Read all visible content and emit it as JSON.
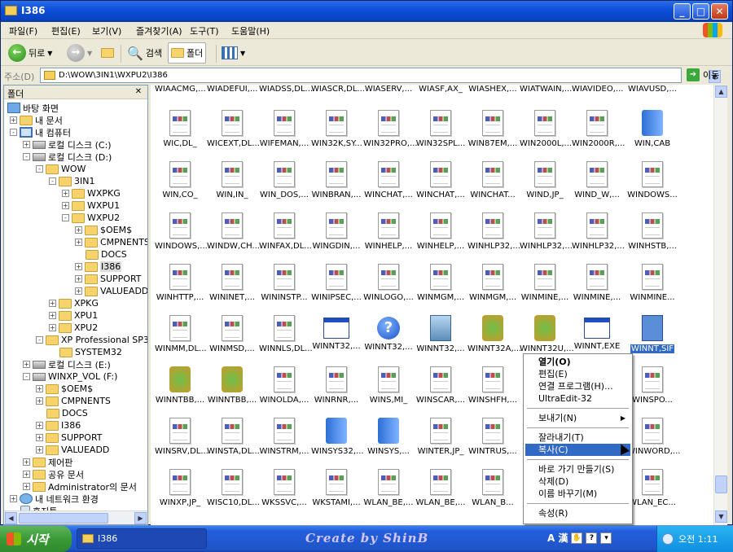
{
  "window": {
    "title": "I386"
  },
  "menu": [
    "파일(F)",
    "편집(E)",
    "보기(V)",
    "즐겨찾기(A)",
    "도구(T)",
    "도움말(H)"
  ],
  "toolbar": {
    "back": "뒤로",
    "search": "검색",
    "folders": "폴더"
  },
  "address": {
    "label": "주소(D)",
    "value": "D:\\WOW\\3IN1\\WXPU2\\I386",
    "go": "이동"
  },
  "folder_pane": {
    "title": "폴더"
  },
  "tree": [
    {
      "label": "바탕 화면",
      "indent": 0,
      "icon": "desktop",
      "exp": ""
    },
    {
      "label": "내 문서",
      "indent": 1,
      "icon": "folder",
      "exp": "+"
    },
    {
      "label": "내 컴퓨터",
      "indent": 1,
      "icon": "computer",
      "exp": "-"
    },
    {
      "label": "로컬 디스크 (C:)",
      "indent": 2,
      "icon": "drive",
      "exp": "+"
    },
    {
      "label": "로컬 디스크 (D:)",
      "indent": 2,
      "icon": "drive",
      "exp": "-"
    },
    {
      "label": "WOW",
      "indent": 3,
      "icon": "folder",
      "exp": "-"
    },
    {
      "label": "3IN1",
      "indent": 4,
      "icon": "folder",
      "exp": "-"
    },
    {
      "label": "WXPKG",
      "indent": 5,
      "icon": "folder",
      "exp": "+"
    },
    {
      "label": "WXPU1",
      "indent": 5,
      "icon": "folder",
      "exp": "+"
    },
    {
      "label": "WXPU2",
      "indent": 5,
      "icon": "folder",
      "exp": "-"
    },
    {
      "label": "$OEM$",
      "indent": 6,
      "icon": "folder",
      "exp": "+"
    },
    {
      "label": "CMPNENTS",
      "indent": 6,
      "icon": "folder",
      "exp": "+"
    },
    {
      "label": "DOCS",
      "indent": 6,
      "icon": "folder",
      "exp": ""
    },
    {
      "label": "I386",
      "indent": 6,
      "icon": "folder",
      "exp": "+"
    },
    {
      "label": "SUPPORT",
      "indent": 6,
      "icon": "folder",
      "exp": "+"
    },
    {
      "label": "VALUEADD",
      "indent": 6,
      "icon": "folder",
      "exp": "+"
    },
    {
      "label": "XPKG",
      "indent": 4,
      "icon": "folder",
      "exp": "+"
    },
    {
      "label": "XPU1",
      "indent": 4,
      "icon": "folder",
      "exp": "+"
    },
    {
      "label": "XPU2",
      "indent": 4,
      "icon": "folder",
      "exp": "+"
    },
    {
      "label": "XP Professional SP3",
      "indent": 3,
      "icon": "folder",
      "exp": "-"
    },
    {
      "label": "SYSTEM32",
      "indent": 4,
      "icon": "folder",
      "exp": ""
    },
    {
      "label": "로컬 디스크 (E:)",
      "indent": 2,
      "icon": "drive",
      "exp": "+"
    },
    {
      "label": "WINXP_VOL (F:)",
      "indent": 2,
      "icon": "drive",
      "exp": "-"
    },
    {
      "label": "$OEM$",
      "indent": 3,
      "icon": "folder",
      "exp": "+"
    },
    {
      "label": "CMPNENTS",
      "indent": 3,
      "icon": "folder",
      "exp": "+"
    },
    {
      "label": "DOCS",
      "indent": 3,
      "icon": "folder",
      "exp": ""
    },
    {
      "label": "I386",
      "indent": 3,
      "icon": "folder",
      "exp": "+"
    },
    {
      "label": "SUPPORT",
      "indent": 3,
      "icon": "folder",
      "exp": "+"
    },
    {
      "label": "VALUEADD",
      "indent": 3,
      "icon": "folder",
      "exp": "+"
    },
    {
      "label": "제어판",
      "indent": 2,
      "icon": "folder",
      "exp": "+"
    },
    {
      "label": "공유 문서",
      "indent": 2,
      "icon": "folder",
      "exp": "+"
    },
    {
      "label": "Administrator의 문서",
      "indent": 2,
      "icon": "folder",
      "exp": "+"
    },
    {
      "label": "내 네트워크 환경",
      "indent": 1,
      "icon": "network",
      "exp": "+"
    },
    {
      "label": "휴지통",
      "indent": 1,
      "icon": "bin",
      "exp": ""
    }
  ],
  "files": [
    [
      "WIAACMG,...",
      "WIADEFUI,...",
      "WIADSS,DL...",
      "WIASCR,DL...",
      "WIASERV,...",
      "WIASF,AX_",
      "WIASHEX,...",
      "WIATWAIN,...",
      "WIAVIDEO,...",
      "WIAVUSD,..."
    ],
    [
      "WIC,DL_",
      "WICEXT,DL...",
      "WIFEMAN,...",
      "WIN32K,SY...",
      "WIN32PRO,...",
      "WIN32SPL...",
      "WIN87EM,...",
      "WIN2000L,...",
      "WIN2000R,...",
      "WIN,CAB"
    ],
    [
      "WIN,CO_",
      "WIN,IN_",
      "WIN_DOS,...",
      "WINBRAN,...",
      "WINCHAT,...",
      "WINCHAT,...",
      "WINCHAT...",
      "WIND,JP_",
      "WIND_W,...",
      "WINDOWS..."
    ],
    [
      "WINDOWS,...",
      "WINDW,CH...",
      "WINFAX,DL...",
      "WINGDIN,...",
      "WINHELP,...",
      "WINHELP,...",
      "WINHLP32,...",
      "WINHLP32,...",
      "WINHLP32,...",
      "WINHSTB,..."
    ],
    [
      "WINHTTP,...",
      "WININET,...",
      "WININSTP...",
      "WINIPSEC,...",
      "WINLOGO,...",
      "WINMGM,...",
      "WINMGM,...",
      "WINMINE,...",
      "WINMINE,...",
      "WINMINE..."
    ],
    [
      "WINMM,DL...",
      "WINMSD,...",
      "WINNLS,DL...",
      "WINNT32,...",
      "WINNT32,...",
      "WINNT32,...",
      "WINNT32A,...",
      "WINNT32U,...",
      "WINNT,EXE",
      "WINNT,SIF"
    ],
    [
      "WINNTBB,...",
      "WINNTBB,...",
      "WINOLDA,...",
      "WINRNR,...",
      "WINS,MI_",
      "WINSCAR,...",
      "WINSHFH,...",
      "",
      "",
      "WINSPO..."
    ],
    [
      "WINSRV,DL...",
      "WINSTA,DL...",
      "WINSTRM,...",
      "WINSYS32,...",
      "WINSYS,...",
      "WINTER,JP_",
      "WINTRUS,...",
      "",
      "",
      "WINWORD,..."
    ],
    [
      "WINXP,JP_",
      "WISC10,DL...",
      "WKSSVC,...",
      "WKSTAMI,...",
      "WLAN_BE,...",
      "WLAN_BE,...",
      "WLAN_B...",
      "",
      "",
      "WLAN_EC..."
    ]
  ],
  "file_icons": {
    "1,9": "cab",
    "5,3": "window",
    "5,4": "help",
    "5,5": "setup",
    "5,6": "package",
    "5,7": "package",
    "5,8": "window",
    "5,9": "sif",
    "6,0": "package",
    "6,1": "package",
    "7,3": "cab",
    "7,4": "cab"
  },
  "selected_file": "WINNT,SIF",
  "context_menu": [
    {
      "label": "열기(O)",
      "bold": true
    },
    {
      "label": "편집(E)"
    },
    {
      "label": "연결 프로그램(H)..."
    },
    {
      "label": "UltraEdit-32"
    },
    {
      "sep": true
    },
    {
      "label": "보내기(N)",
      "sub": true
    },
    {
      "sep": true
    },
    {
      "label": "잘라내기(T)"
    },
    {
      "label": "복사(C)",
      "highlight": true
    },
    {
      "sep": true
    },
    {
      "label": "바로 가기 만들기(S)"
    },
    {
      "label": "삭제(D)"
    },
    {
      "label": "이름 바꾸기(M)"
    },
    {
      "sep": true
    },
    {
      "label": "속성(R)"
    }
  ],
  "taskbar": {
    "start": "시작",
    "item": "I386",
    "brand": "Create by ShinB",
    "ime": "A 漢",
    "clock": "오전 1:11"
  }
}
